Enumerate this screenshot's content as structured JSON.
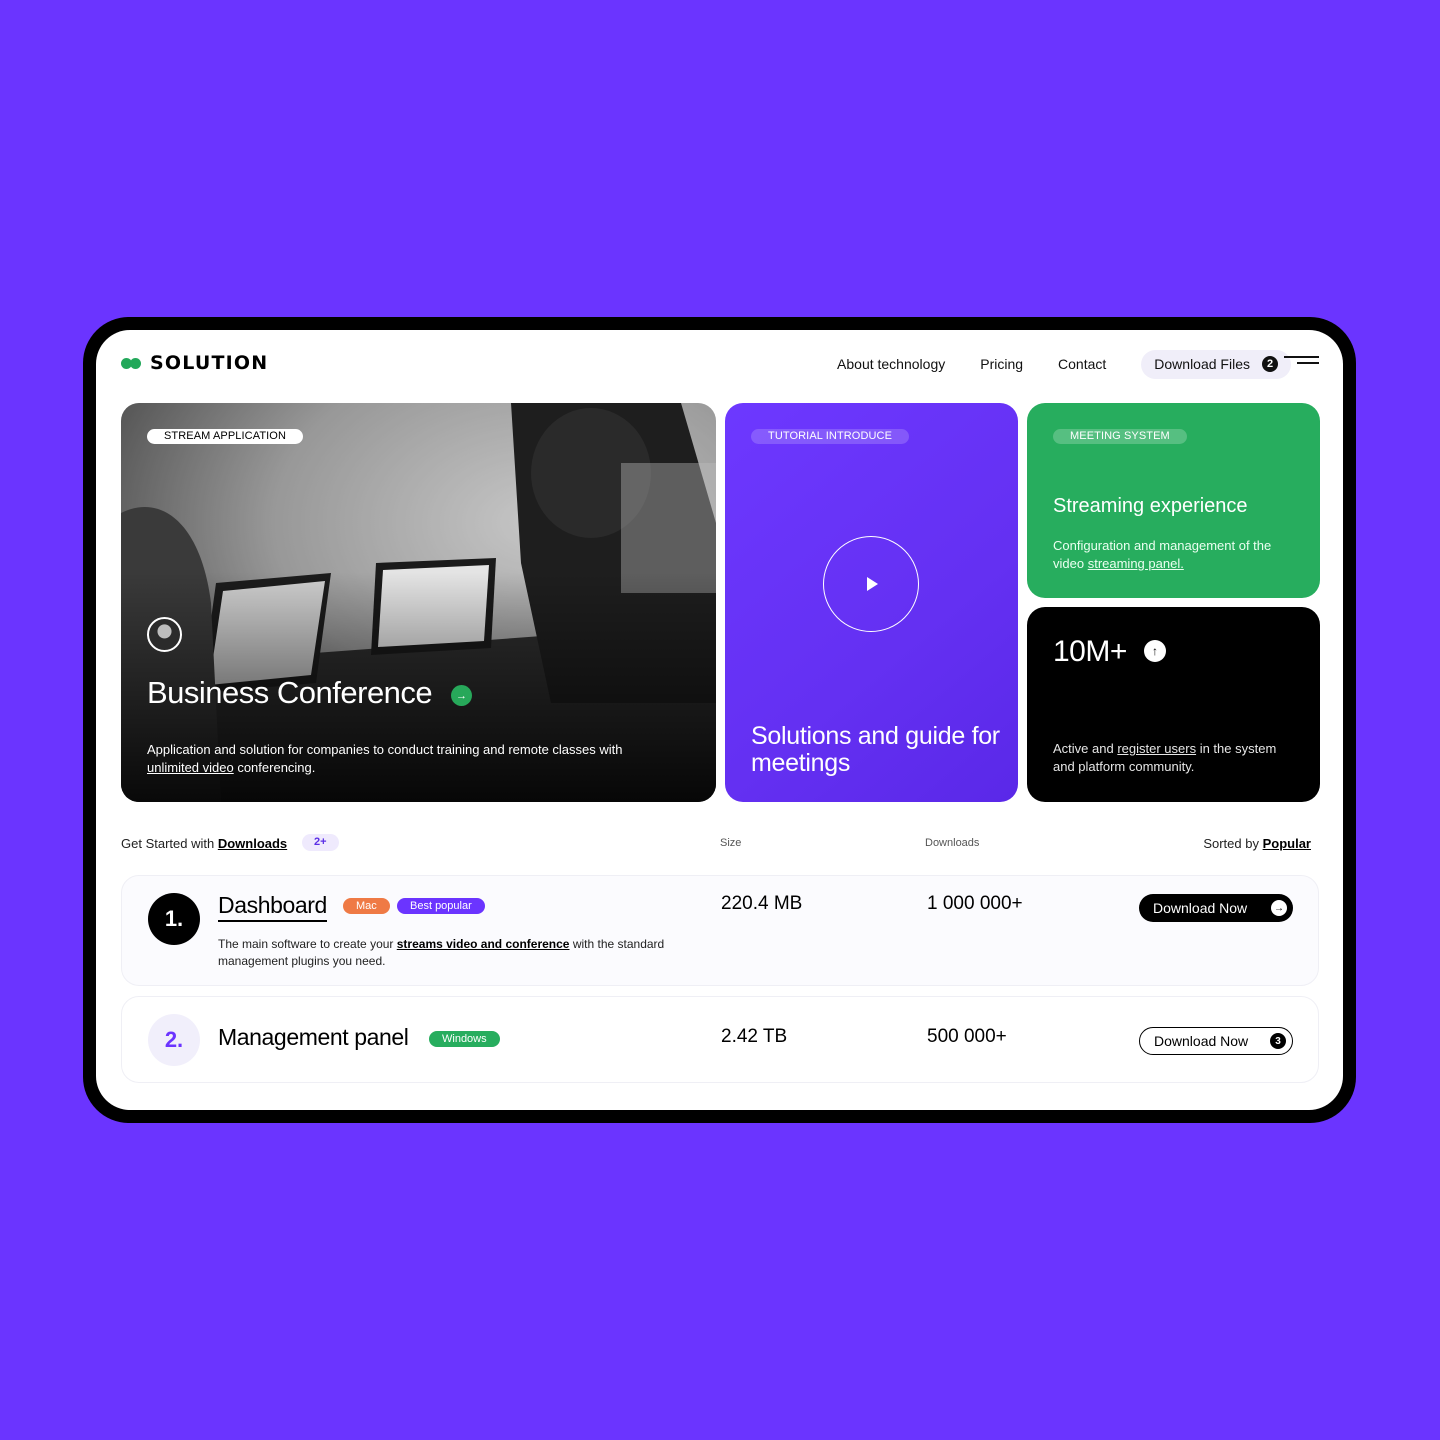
{
  "brand": {
    "name": "SOLUTION"
  },
  "nav": {
    "items": [
      "About technology",
      "Pricing",
      "Contact"
    ],
    "download_files": {
      "label": "Download Files",
      "count": "2"
    }
  },
  "cards": {
    "photo": {
      "tag": "STREAM APPLICATION",
      "title": "Business Conference",
      "desc_before": "Application and solution for companies to conduct training and remote classes with ",
      "desc_link": "unlimited video",
      "desc_after": " conferencing."
    },
    "tutorial": {
      "tag": "TUTORIAL INTRODUCE",
      "title": "Solutions and guide for meetings"
    },
    "meeting": {
      "tag": "MEETING SYSTEM",
      "title": "Streaming experience",
      "desc_before": "Configuration and management of the video ",
      "desc_link": "streaming panel."
    },
    "stats": {
      "value": "10M+",
      "desc_before": "Active and ",
      "desc_link": "register users",
      "desc_after": " in the system and platform community."
    }
  },
  "list": {
    "header": {
      "prefix": "Get Started with ",
      "link": "Downloads",
      "badge": "2+",
      "col_size": "Size",
      "col_downloads": "Downloads",
      "sorted_prefix": "Sorted by ",
      "sorted_link": "Popular"
    },
    "rows": [
      {
        "index": "1.",
        "title": "Dashboard",
        "tags": [
          "Mac",
          "Best popular"
        ],
        "desc_before": "The main software to create your ",
        "desc_link": "streams video and conference",
        "desc_after": " with the standard management plugins you need.",
        "size": "220.4 MB",
        "downloads": "1 000 000+",
        "button": "Download Now"
      },
      {
        "index": "2.",
        "title": "Management panel",
        "tags": [
          "Windows"
        ],
        "size": "2.42 TB",
        "downloads": "500 000+",
        "button": "Download Now",
        "button_badge": "3"
      }
    ]
  },
  "colors": {
    "background": "#6b34ff",
    "accent_purple": "#6b34ff",
    "accent_green": "#27ad5e",
    "accent_orange": "#ef7a45"
  },
  "icons": [
    "play-icon",
    "arrow-right-icon",
    "arrow-up-icon",
    "menu-icon"
  ]
}
